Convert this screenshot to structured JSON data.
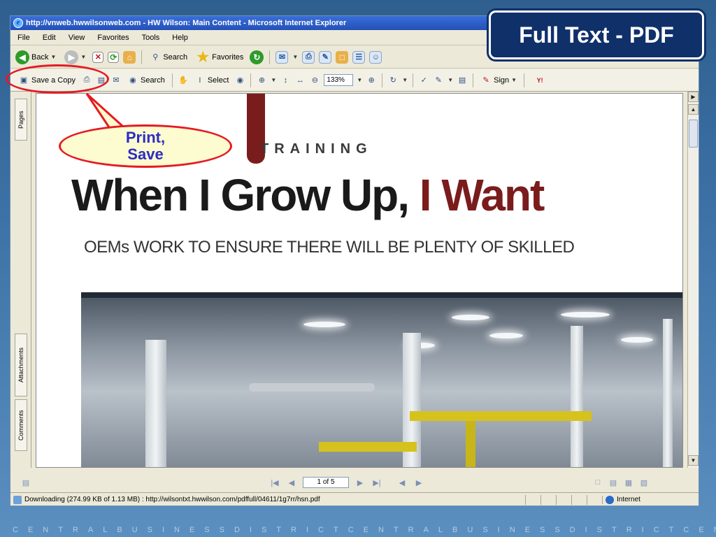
{
  "window": {
    "title": "http://vnweb.hwwilsonweb.com - HW Wilson: Main Content - Microsoft Internet Explorer"
  },
  "menu": [
    "File",
    "Edit",
    "View",
    "Favorites",
    "Tools",
    "Help"
  ],
  "ie_toolbar": {
    "back_label": "Back",
    "search_label": "Search",
    "favorites_label": "Favorites"
  },
  "pdf_toolbar": {
    "save_copy_label": "Save a Copy",
    "search_label": "Search",
    "select_label": "Select",
    "zoom_value": "133%",
    "sign_label": "Sign"
  },
  "left_rail": {
    "pages_label": "Pages",
    "attachments_label": "Attachments",
    "comments_label": "Comments"
  },
  "document": {
    "kicker": "TRAINING",
    "headline_main": "When I Grow Up,",
    "headline_accent": "I Want",
    "subheadline": "OEMs WORK TO ENSURE THERE WILL BE PLENTY OF SKILLED"
  },
  "navigation": {
    "page_indicator": "1 of 5"
  },
  "status": {
    "text": "Downloading (274.99 KB of 1.13 MB) : http://wilsontxt.hwwilson.com/pdffull/04611/1g7rr/hsn.pdf",
    "zone": "Internet"
  },
  "slide": {
    "title": "Full Text - PDF",
    "callout_line1": "Print,",
    "callout_line2": "Save",
    "footer": "CENTRALBUSINESSDISTRICTCENTRALBUSINESSDISTRICTCENTRA"
  },
  "colors": {
    "slide_title_bg": "#10306a",
    "callout_border": "#e41b23",
    "callout_text": "#2c2cc4",
    "callout_fill": "#fdfbd0",
    "headline_accent": "#7a1c1c"
  }
}
